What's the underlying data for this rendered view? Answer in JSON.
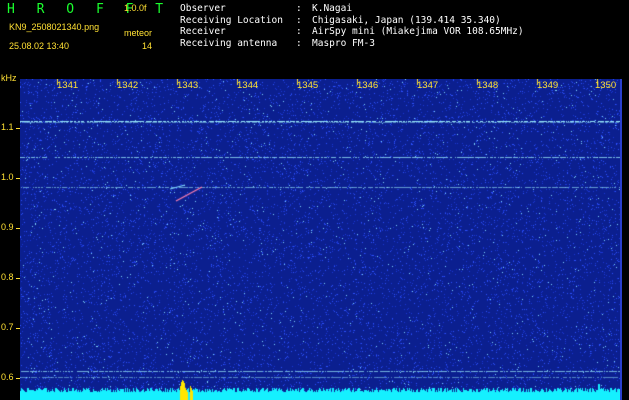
{
  "header": {
    "logo": "H R O F F T",
    "version": "1.0.0f",
    "filename": "KN9_2508021340.png",
    "label_meteor": "meteor",
    "meteor_count": "14",
    "datetime": "25.08.02 13:40"
  },
  "metadata": [
    {
      "key": "Observer",
      "sep": ":",
      "value": "K.Nagai"
    },
    {
      "key": "Receiving Location",
      "sep": ":",
      "value": "Chigasaki, Japan (139.414 35.340)"
    },
    {
      "key": "Receiver",
      "sep": ":",
      "value": "AirSpy mini (Miakejima VOR 108.65MHz)"
    },
    {
      "key": "Receiving antenna",
      "sep": ":",
      "value": "Maspro FM-3"
    }
  ],
  "axis": {
    "y_unit": "kHz",
    "y_ticks": [
      "1.1",
      "1.0",
      "0.9",
      "0.8",
      "0.7",
      "0.6"
    ],
    "x_ticks": [
      "1341",
      "1342",
      "1343",
      "1344",
      "1345",
      "1346",
      "1347",
      "1348",
      "1349",
      "1350"
    ]
  },
  "colors": {
    "background": "#0b1f8f",
    "noise_dim": "#2e52ff",
    "noise_bright": "#7fd6ff",
    "carrier": "#9df0ff",
    "spectrum": "#15f0ff",
    "burst": "#ffe600",
    "label": "#ffe033"
  }
}
